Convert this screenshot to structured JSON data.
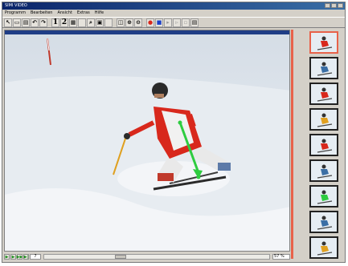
{
  "window": {
    "title": "SIMI VIDEO"
  },
  "menu": [
    "Programm",
    "Bearbeiten",
    "Ansicht",
    "Extras",
    "Hilfe"
  ],
  "toolbar": {
    "buttons": [
      {
        "name": "pointer-tool-button",
        "glyph": "↖"
      },
      {
        "name": "open-button",
        "glyph": "▭"
      },
      {
        "name": "save-button",
        "glyph": "▤"
      },
      {
        "name": "undo-button",
        "glyph": "↶"
      },
      {
        "name": "redo-button",
        "glyph": "↷"
      },
      {
        "name": "view-one-button",
        "glyph": "1"
      },
      {
        "name": "view-two-button",
        "glyph": "2"
      },
      {
        "name": "grid-button",
        "glyph": "▦"
      },
      {
        "name": "blank-button",
        "glyph": ""
      },
      {
        "name": "zoom-button",
        "glyph": "⌕"
      },
      {
        "name": "monitor-button",
        "glyph": "▣"
      },
      {
        "name": "disabled-button",
        "glyph": ""
      },
      {
        "name": "measure-button",
        "glyph": "◫"
      },
      {
        "name": "zoom-in-button",
        "glyph": "⊕"
      },
      {
        "name": "zoom-out-button",
        "glyph": "⊖"
      },
      {
        "name": "record-button",
        "glyph": "●"
      },
      {
        "name": "stop-button",
        "glyph": "■"
      },
      {
        "name": "play-grey-button",
        "glyph": "▸"
      },
      {
        "name": "step-grey-button",
        "glyph": "▹"
      },
      {
        "name": "frame-grey-button",
        "glyph": "▫"
      },
      {
        "name": "export-button",
        "glyph": "▤"
      }
    ]
  },
  "view_header": "",
  "playback": {
    "buttons": [
      "▶",
      "▶",
      "▶▶",
      "▶|"
    ],
    "frame": "7",
    "zoom": "57 %",
    "scroll_position": 0.33
  },
  "thumbnails": 9,
  "colors": {
    "accent": "#e8624a",
    "arrow": "#2ecc40",
    "header": "#1f3d86"
  }
}
